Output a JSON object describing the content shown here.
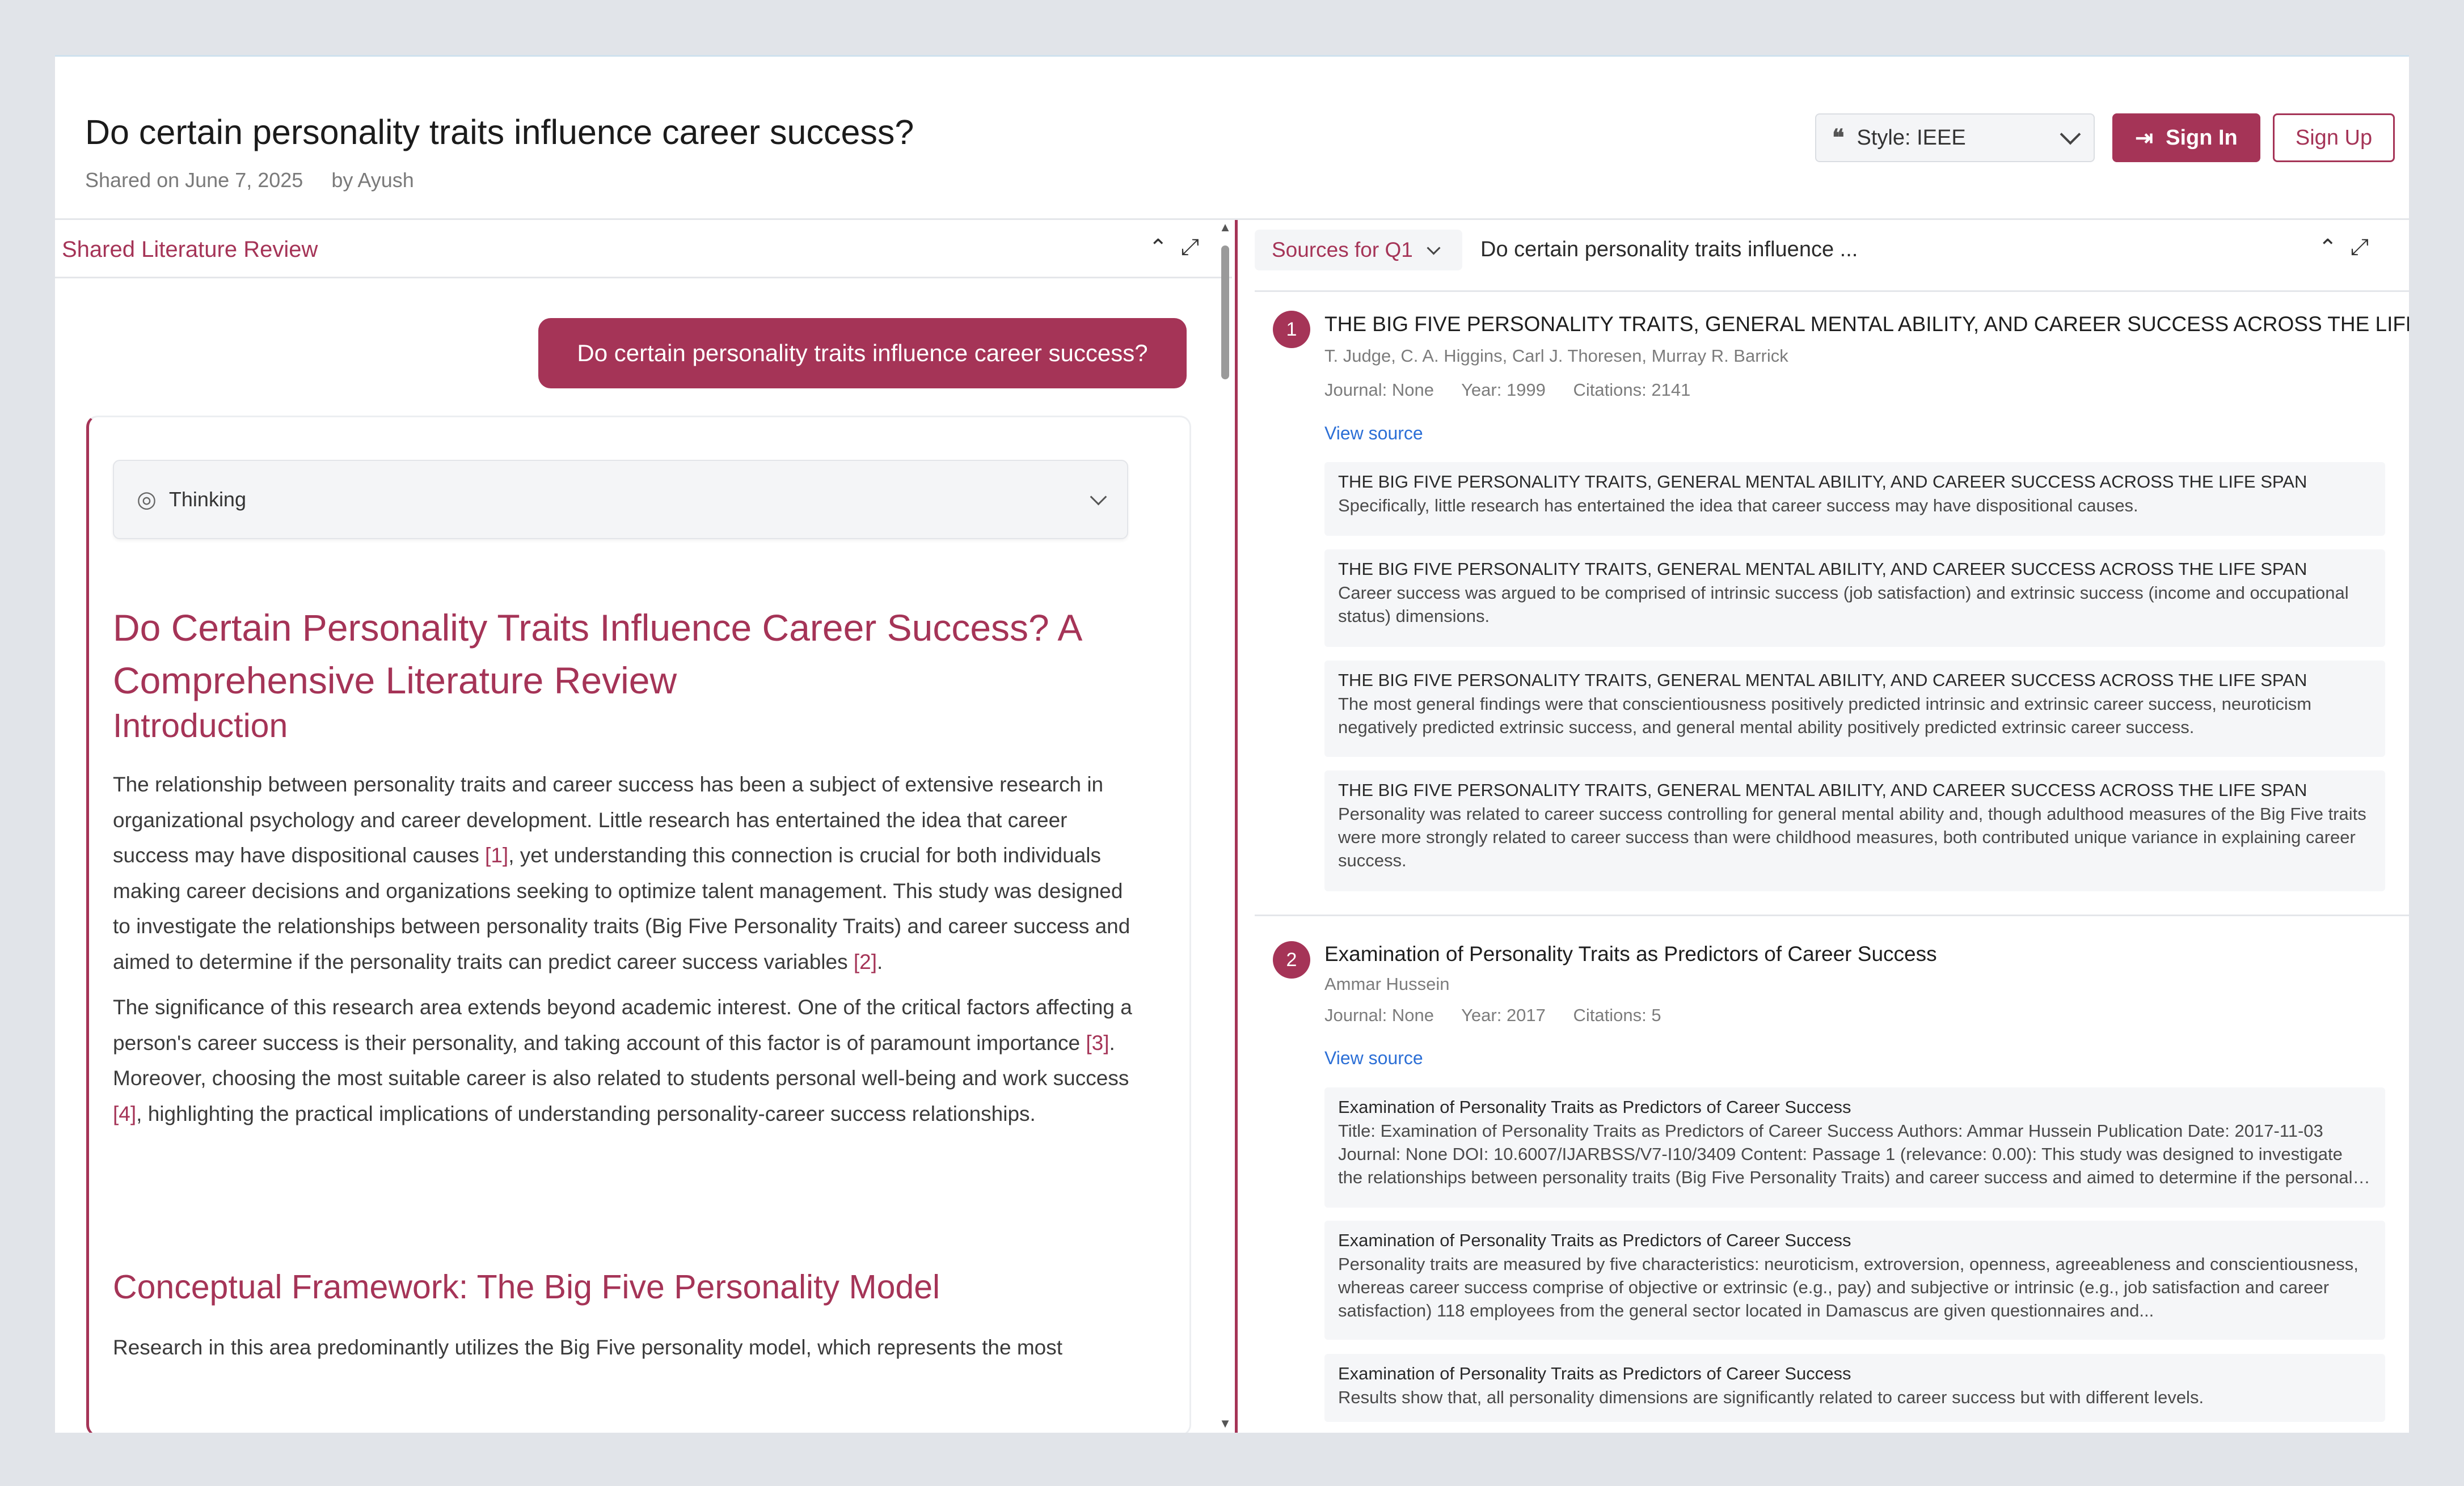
{
  "header": {
    "title": "Do certain personality traits influence career success?",
    "shared_on": "Shared on June 7, 2025",
    "shared_by": "by Ayush",
    "style_label": "Style: IEEE",
    "sign_in": "Sign In",
    "sign_up": "Sign Up"
  },
  "left": {
    "panel_title": "Shared Literature Review",
    "query": "Do certain personality traits influence career success?",
    "thinking_label": "Thinking",
    "review_title": "Do Certain Personality Traits Influence Career Success? A Comprehensive Literature Review",
    "intro_heading": "Introduction",
    "intro_p1_a": "The relationship between personality traits and career success has been a subject of extensive research in organizational psychology and career development. Little research has entertained the idea that career success may have dispositional causes ",
    "intro_p1_c1": "[1]",
    "intro_p1_b": ", yet understanding this connection is crucial for both individuals making career decisions and organizations seeking to optimize talent management. This study was designed to investigate the relationships between personality traits (Big Five Personality Traits) and career success and aimed to determine if the personality traits can predict career success variables ",
    "intro_p1_c2": "[2]",
    "intro_p1_end": ".",
    "intro_p2_a": "The significance of this research area extends beyond academic interest. One of the critical factors affecting a person's career success is their personality, and taking account of this factor is of paramount importance ",
    "intro_p2_c3": "[3]",
    "intro_p2_b": ". Moreover, choosing the most suitable career is also related to students personal well-being and work success ",
    "intro_p2_c4": "[4]",
    "intro_p2_end": ", highlighting the practical implications of understanding personality-career success relationships.",
    "framework_heading": "Conceptual Framework: The Big Five Personality Model",
    "framework_p1": "Research in this area predominantly utilizes the Big Five personality model, which represents the most"
  },
  "right": {
    "sources_tab": "Sources for Q1",
    "sources_query": "Do certain personality traits influence ...",
    "sources": [
      {
        "num": "1",
        "title": "THE BIG FIVE PERSONALITY TRAITS, GENERAL MENTAL ABILITY, AND CAREER SUCCESS ACROSS THE LIFE SPAN",
        "authors": "T. Judge, C. A. Higgins, Carl J. Thoresen, Murray R. Barrick",
        "journal": "Journal: None",
        "year": "Year: 1999",
        "citations": "Citations: 2141",
        "view": "View source",
        "excerpts": [
          {
            "title": "THE BIG FIVE PERSONALITY TRAITS, GENERAL MENTAL ABILITY, AND CAREER SUCCESS ACROSS THE LIFE SPAN",
            "text": "Specifically, little research has entertained the idea that career success may have dispositional causes."
          },
          {
            "title": "THE BIG FIVE PERSONALITY TRAITS, GENERAL MENTAL ABILITY, AND CAREER SUCCESS ACROSS THE LIFE SPAN",
            "text": "Career success was argued to be comprised of intrinsic success (job satisfaction) and extrinsic success (income and occupational status) dimensions."
          },
          {
            "title": "THE BIG FIVE PERSONALITY TRAITS, GENERAL MENTAL ABILITY, AND CAREER SUCCESS ACROSS THE LIFE SPAN",
            "text": "The most general findings were that conscientiousness positively predicted intrinsic and extrinsic career success, neuroticism negatively predicted extrinsic success, and general mental ability positively predicted extrinsic career success."
          },
          {
            "title": "THE BIG FIVE PERSONALITY TRAITS, GENERAL MENTAL ABILITY, AND CAREER SUCCESS ACROSS THE LIFE SPAN",
            "text": "Personality was related to career success controlling for general mental ability and, though adulthood measures of the Big Five traits were more strongly related to career success than were childhood measures, both contributed unique variance in explaining career success."
          }
        ]
      },
      {
        "num": "2",
        "title": "Examination of Personality Traits as Predictors of Career Success",
        "authors": "Ammar Hussein",
        "journal": "Journal: None",
        "year": "Year: 2017",
        "citations": "Citations: 5",
        "view": "View source",
        "excerpts": [
          {
            "title": "Examination of Personality Traits as Predictors of Career Success",
            "text": "Title: Examination of Personality Traits as Predictors of Career Success Authors: Ammar Hussein Publication Date: 2017-11-03 Journal: None DOI: 10.6007/IJARBSS/V7-I10/3409 Content: Passage 1 (relevance: 0.00): This study was designed to investigate the relationships between personality traits (Big Five Personality Traits) and career success and aimed to determine if the personality traits can predict career success variables."
          },
          {
            "title": "Examination of Personality Traits as Predictors of Career Success",
            "text": "Personality traits are measured by five characteristics: neuroticism, extroversion, openness, agreeableness and conscientiousness, whereas career success comprise of objective or extrinsic (e.g., pay) and subjective or intrinsic (e.g., job satisfaction and career satisfaction) 118 employees from the general sector located in Damascus are given questionnaires and..."
          },
          {
            "title": "Examination of Personality Traits as Predictors of Career Success",
            "text": "Results show that, all personality dimensions are significantly related to career success but with different levels."
          }
        ]
      }
    ]
  }
}
